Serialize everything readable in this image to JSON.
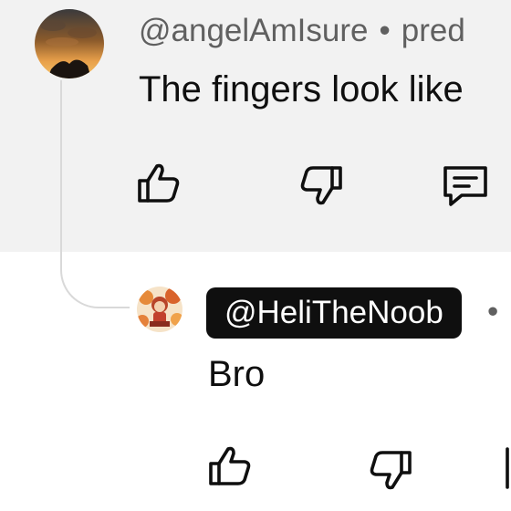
{
  "top_comment": {
    "author": "@angelAmIsure",
    "separator": "•",
    "time": "pred",
    "text": "The fingers look like",
    "actions": {
      "like_icon": "thumbs-up-icon",
      "dislike_icon": "thumbs-down-icon",
      "reply_icon": "reply-comment-icon"
    }
  },
  "reply": {
    "author": "@HeliTheNoob",
    "separator": "•",
    "text": "Bro",
    "actions": {
      "like_icon": "thumbs-up-icon",
      "dislike_icon": "thumbs-down-icon",
      "reply_icon": "reply-comment-icon"
    }
  },
  "colors": {
    "top_background": "#f2f2f2",
    "chip_background": "#0f0f0f",
    "chip_text": "#ffffff",
    "meta_text": "#606060",
    "thread_line": "#d9d9d9"
  }
}
